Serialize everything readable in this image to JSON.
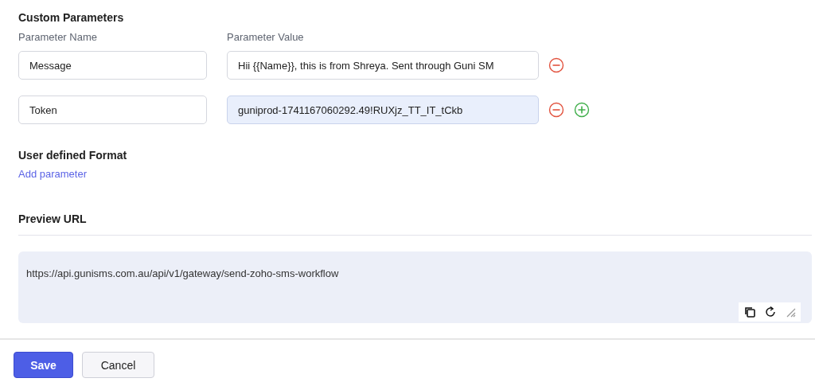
{
  "custom_parameters": {
    "title": "Custom Parameters",
    "name_label": "Parameter Name",
    "value_label": "Parameter Value",
    "rows": [
      {
        "name": "Message",
        "value": "Hii {{Name}}, this is from Shreya. Sent through Guni SM",
        "focused": false,
        "addable": false
      },
      {
        "name": "Token",
        "value": "guniprod-1741167060292.49!RUXjz_TT_IT_tCkb",
        "focused": true,
        "addable": true
      }
    ]
  },
  "user_defined_format": {
    "title": "User defined Format",
    "link": "Add parameter"
  },
  "preview": {
    "title": "Preview URL",
    "url": "https://api.gunisms.com.au/api/v1/gateway/send-zoho-sms-workflow"
  },
  "buttons": [
    {
      "label": "Save",
      "kind": "primary"
    },
    {
      "label": "Cancel",
      "kind": "secondary"
    }
  ]
}
